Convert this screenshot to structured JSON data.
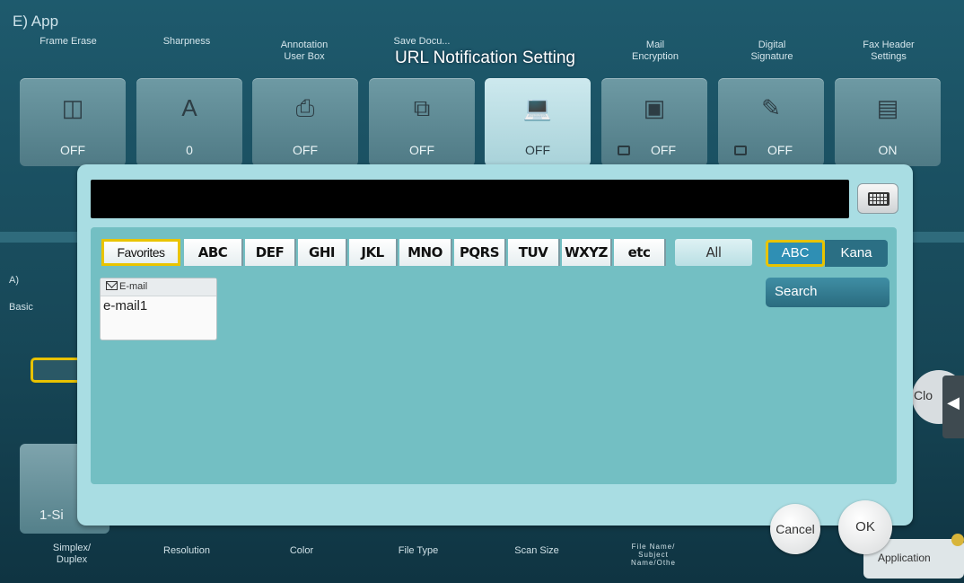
{
  "app": {
    "title": "E)  App",
    "tabs": [
      {
        "label": "Frame Erase",
        "value": "OFF",
        "icon": "frame-erase-icon"
      },
      {
        "label": "Sharpness",
        "value": "0",
        "icon": "sharpness-icon"
      },
      {
        "label": "Annotation\nUser Box",
        "value": "OFF",
        "icon": "user-box-icon"
      },
      {
        "label": "Save Docu...",
        "value": "OFF",
        "icon": "save-document-icon"
      },
      {
        "label": "",
        "value": "OFF",
        "icon": "url-notification-icon"
      },
      {
        "label": "Mail\nEncryption",
        "value": "OFF",
        "icon": "mail-encryption-icon"
      },
      {
        "label": "Digital\nSignature",
        "value": "OFF",
        "icon": "digital-signature-icon"
      },
      {
        "label": "Fax Header\nSettings",
        "value": "ON",
        "icon": "fax-header-icon"
      }
    ],
    "left_texts": {
      "a": "A)",
      "basic": "Basic"
    },
    "one_sided_label": "1-Si",
    "close_label": "Clo",
    "application_label": "Application",
    "bottom_tabs": [
      "Simplex/\nDuplex",
      "Resolution",
      "Color",
      "File Type",
      "Scan Size",
      "File Name/\nSubject\nName/Othe"
    ]
  },
  "dialog": {
    "title": "URL Notification Setting",
    "entry_value": "",
    "index_tabs": [
      "Favorites",
      "ABC",
      "DEF",
      "GHI",
      "JKL",
      "MNO",
      "PQRS",
      "TUV",
      "WXYZ",
      "etc"
    ],
    "all_label": "All",
    "mode_abc": "ABC",
    "mode_kana": "Kana",
    "search_label": "Search",
    "destinations": [
      {
        "type": "E-mail",
        "name": "e-mail1"
      }
    ],
    "cancel_label": "Cancel",
    "ok_label": "OK"
  }
}
